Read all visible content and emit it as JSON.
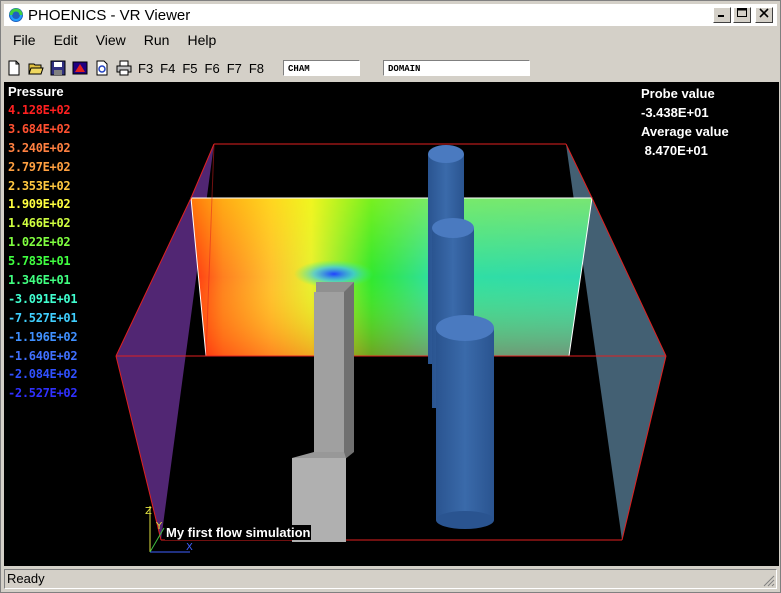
{
  "window": {
    "title": "PHOENICS - VR Viewer"
  },
  "menu": [
    "File",
    "Edit",
    "View",
    "Run",
    "Help"
  ],
  "toolbar": {
    "fkeys": [
      "F3",
      "F4",
      "F5",
      "F6",
      "F7",
      "F8"
    ],
    "field1": "CHAM",
    "field2": "DOMAIN"
  },
  "legend": {
    "title": "Pressure",
    "values": [
      {
        "label": "4.128E+02",
        "color": "#ff2020"
      },
      {
        "label": "3.684E+02",
        "color": "#ff5030"
      },
      {
        "label": "3.240E+02",
        "color": "#ff8040"
      },
      {
        "label": "2.797E+02",
        "color": "#ffa040"
      },
      {
        "label": "2.353E+02",
        "color": "#ffc840"
      },
      {
        "label": "1.909E+02",
        "color": "#ffff40"
      },
      {
        "label": "1.466E+02",
        "color": "#d0ff40"
      },
      {
        "label": "1.022E+02",
        "color": "#80ff40"
      },
      {
        "label": "5.783E+01",
        "color": "#40ff40"
      },
      {
        "label": "1.346E+01",
        "color": "#40ff80"
      },
      {
        "label": "-3.091E+01",
        "color": "#40ffd0"
      },
      {
        "label": "-7.527E+01",
        "color": "#40d0ff"
      },
      {
        "label": "-1.196E+02",
        "color": "#4090ff"
      },
      {
        "label": "-1.640E+02",
        "color": "#4070ff"
      },
      {
        "label": "-2.084E+02",
        "color": "#3050ff"
      },
      {
        "label": "-2.527E+02",
        "color": "#3030ff"
      }
    ]
  },
  "probe": {
    "probe_label": "Probe value",
    "probe_value": "-3.438E+01",
    "avg_label": "Average value",
    "avg_value": " 8.470E+01"
  },
  "caption": "My first flow simulation",
  "status": "Ready",
  "axis_labels": [
    "Z",
    "Y",
    "X"
  ]
}
